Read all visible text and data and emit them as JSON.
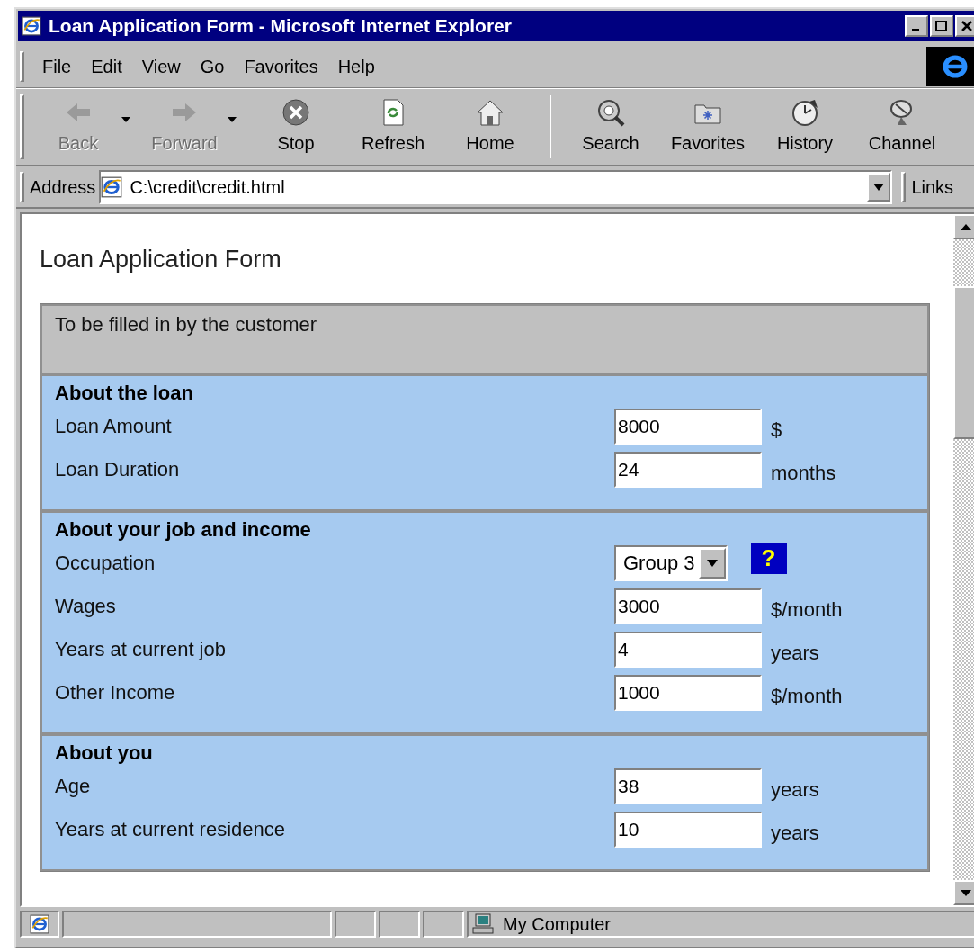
{
  "window": {
    "title": "Loan Application Form - Microsoft Internet Explorer"
  },
  "menu": [
    "File",
    "Edit",
    "View",
    "Go",
    "Favorites",
    "Help"
  ],
  "toolbar": [
    {
      "label": "Back",
      "disabled": true
    },
    {
      "label": "Forward",
      "disabled": true
    },
    {
      "label": "Stop",
      "disabled": false
    },
    {
      "label": "Refresh",
      "disabled": false
    },
    {
      "label": "Home",
      "disabled": false
    },
    {
      "label": "Search",
      "disabled": false
    },
    {
      "label": "Favorites",
      "disabled": false
    },
    {
      "label": "History",
      "disabled": false
    },
    {
      "label": "Channel",
      "disabled": false
    }
  ],
  "address": {
    "label": "Address",
    "value": "C:\\credit\\credit.html",
    "links": "Links"
  },
  "page": {
    "title": "Loan Application Form",
    "banner": "To be filled in by the customer",
    "sections": [
      {
        "title": "About the loan",
        "rows": [
          {
            "kind": "text",
            "label": "Loan Amount",
            "value": "8000",
            "unit": "$"
          },
          {
            "kind": "text",
            "label": "Loan Duration",
            "value": "24",
            "unit": "months"
          }
        ]
      },
      {
        "title": "About your job and income",
        "rows": [
          {
            "kind": "select",
            "label": "Occupation",
            "value": "Group 3",
            "help": "?"
          },
          {
            "kind": "text",
            "label": "Wages",
            "value": "3000",
            "unit": "$/month"
          },
          {
            "kind": "text",
            "label": "Years at current job",
            "value": "4",
            "unit": "years"
          },
          {
            "kind": "text",
            "label": "Other Income",
            "value": "1000",
            "unit": "$/month"
          }
        ]
      },
      {
        "title": "About you",
        "rows": [
          {
            "kind": "text",
            "label": "Age",
            "value": "38",
            "unit": "years"
          },
          {
            "kind": "text",
            "label": "Years at current residence",
            "value": "10",
            "unit": "years"
          }
        ]
      }
    ]
  },
  "status_bar": {
    "zone": "My Computer"
  }
}
